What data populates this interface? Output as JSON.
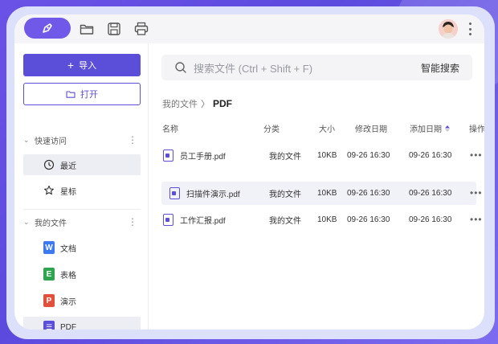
{
  "colors": {
    "accent": "#5b4fd9",
    "frame": "#6b52e6",
    "active_bg": "#ededf4"
  },
  "toolbar": {
    "icons": [
      "pen-logo-icon",
      "folder-icon",
      "save-icon",
      "print-icon"
    ]
  },
  "sidebar": {
    "import_label": "导入",
    "open_label": "打开",
    "quick_access": {
      "label": "快速访问",
      "items": [
        {
          "label": "最近",
          "icon": "clock-icon",
          "active": true
        },
        {
          "label": "星标",
          "icon": "star-icon",
          "active": false
        }
      ]
    },
    "my_files": {
      "label": "我的文件",
      "items": [
        {
          "label": "文档",
          "icon": "doc-icon",
          "icon_letter": "W",
          "color": "#3b7bef"
        },
        {
          "label": "表格",
          "icon": "sheet-icon",
          "icon_letter": "E",
          "color": "#2ea44f"
        },
        {
          "label": "演示",
          "icon": "slides-icon",
          "icon_letter": "P",
          "color": "#e2503b"
        },
        {
          "label": "PDF",
          "icon": "pdf-icon",
          "icon_letter": "☰",
          "color": "#5b4fd9",
          "active": true
        }
      ]
    }
  },
  "search": {
    "placeholder": "搜索文件 (Ctrl + Shift + F)",
    "smart_label": "智能搜索"
  },
  "breadcrumb": {
    "root": "我的文件",
    "separator": "〉",
    "current": "PDF"
  },
  "table": {
    "columns": [
      "名称",
      "分类",
      "大小",
      "修改日期",
      "添加日期",
      "操作"
    ],
    "sort_column": "添加日期",
    "rows": [
      {
        "name": "员工手册.pdf",
        "category": "我的文件",
        "size": "10KB",
        "modified": "09-26 16:30",
        "added": "09-26 16:30",
        "action": "•••"
      },
      {
        "name": "扫描件演示.pdf",
        "category": "我的文件",
        "size": "10KB",
        "modified": "09-26 16:30",
        "added": "09-26 16:30",
        "action": "•••",
        "selected": true
      },
      {
        "name": "工作汇报.pdf",
        "category": "我的文件",
        "size": "10KB",
        "modified": "09-26 16:30",
        "added": "09-26 16:30",
        "action": "•••"
      }
    ]
  }
}
